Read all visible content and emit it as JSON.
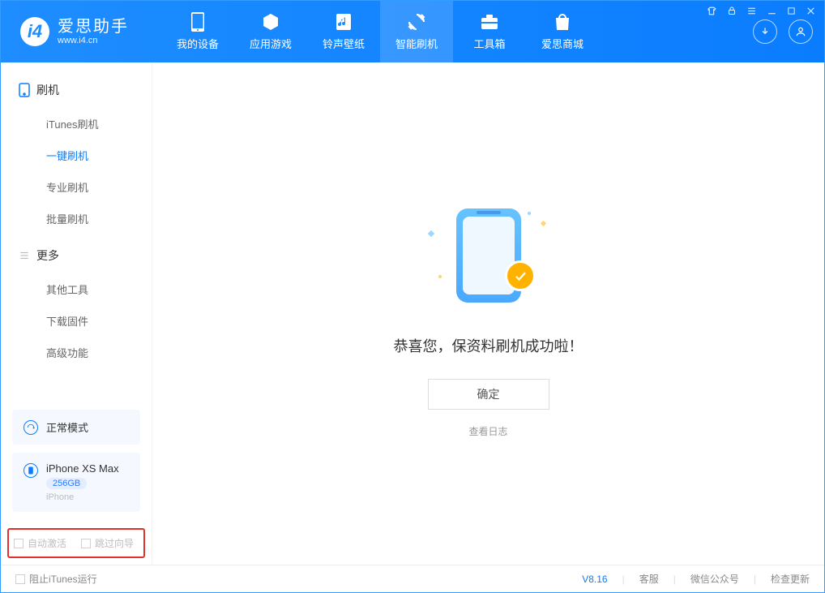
{
  "app": {
    "title": "爱思助手",
    "url": "www.i4.cn"
  },
  "tabs": [
    {
      "label": "我的设备"
    },
    {
      "label": "应用游戏"
    },
    {
      "label": "铃声壁纸"
    },
    {
      "label": "智能刷机"
    },
    {
      "label": "工具箱"
    },
    {
      "label": "爱思商城"
    }
  ],
  "sidebar": {
    "section1_title": "刷机",
    "section1_items": [
      {
        "label": "iTunes刷机"
      },
      {
        "label": "一键刷机"
      },
      {
        "label": "专业刷机"
      },
      {
        "label": "批量刷机"
      }
    ],
    "section2_title": "更多",
    "section2_items": [
      {
        "label": "其他工具"
      },
      {
        "label": "下载固件"
      },
      {
        "label": "高级功能"
      }
    ],
    "mode_card": {
      "label": "正常模式"
    },
    "device_card": {
      "name": "iPhone XS Max",
      "storage": "256GB",
      "type": "iPhone"
    },
    "opts": {
      "auto_activate": "自动激活",
      "skip_guide": "跳过向导"
    }
  },
  "main": {
    "success_text": "恭喜您，保资料刷机成功啦！",
    "ok_label": "确定",
    "view_log": "查看日志"
  },
  "status": {
    "block_itunes": "阻止iTunes运行",
    "version": "V8.16",
    "support": "客服",
    "wechat": "微信公众号",
    "update": "检查更新"
  }
}
